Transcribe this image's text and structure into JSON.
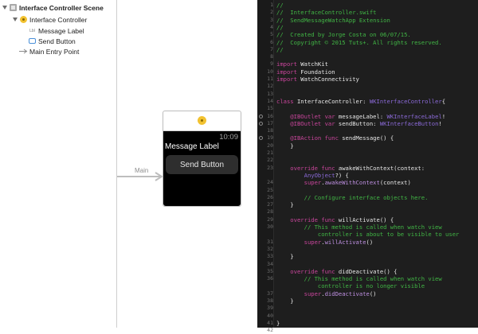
{
  "outline": {
    "scene_label": "Interface Controller Scene",
    "controller_label": "Interface Controller",
    "items": [
      {
        "label": "Message Label",
        "icon_text": "Lbl"
      },
      {
        "label": "Send Button"
      }
    ],
    "entry_point_label": "Main Entry Point"
  },
  "canvas": {
    "entry_label": "Main",
    "watch": {
      "time": "10:09",
      "message_label": "Message Label",
      "send_button": "Send Button"
    }
  },
  "editor": {
    "lines": [
      {
        "n": "1",
        "tokens": [
          {
            "t": "//",
            "c": "com"
          }
        ]
      },
      {
        "n": "2",
        "tokens": [
          {
            "t": "//  InterfaceController.swift",
            "c": "com"
          }
        ]
      },
      {
        "n": "3",
        "tokens": [
          {
            "t": "//  SendMessageWatchApp Extension",
            "c": "com"
          }
        ]
      },
      {
        "n": "4",
        "tokens": [
          {
            "t": "//",
            "c": "com"
          }
        ]
      },
      {
        "n": "5",
        "tokens": [
          {
            "t": "//  Created by Jorge Costa on 06/07/15.",
            "c": "com"
          }
        ]
      },
      {
        "n": "6",
        "tokens": [
          {
            "t": "//  Copyright © 2015 Tuts+. All rights reserved.",
            "c": "com"
          }
        ]
      },
      {
        "n": "7",
        "tokens": [
          {
            "t": "//",
            "c": "com"
          }
        ]
      },
      {
        "n": "8",
        "tokens": []
      },
      {
        "n": "9",
        "tokens": [
          {
            "t": "import",
            "c": "kw"
          },
          {
            "t": " WatchKit",
            "c": "pl"
          }
        ]
      },
      {
        "n": "10",
        "tokens": [
          {
            "t": "import",
            "c": "kw"
          },
          {
            "t": " Foundation",
            "c": "pl"
          }
        ]
      },
      {
        "n": "11",
        "tokens": [
          {
            "t": "import",
            "c": "kw"
          },
          {
            "t": " WatchConnectivity",
            "c": "pl"
          }
        ]
      },
      {
        "n": "12",
        "tokens": []
      },
      {
        "n": "13",
        "tokens": []
      },
      {
        "n": "14",
        "tokens": [
          {
            "t": "class",
            "c": "kw"
          },
          {
            "t": " InterfaceController: ",
            "c": "pl"
          },
          {
            "t": "WKInterfaceController",
            "c": "type"
          },
          {
            "t": "{",
            "c": "pl"
          }
        ]
      },
      {
        "n": "15",
        "tokens": []
      },
      {
        "n": "16",
        "dot": true,
        "tokens": [
          {
            "t": "    @IBOutlet",
            "c": "kw"
          },
          {
            "t": " var",
            "c": "kw"
          },
          {
            "t": " messageLabel: ",
            "c": "pl"
          },
          {
            "t": "WKInterfaceLabel",
            "c": "type"
          },
          {
            "t": "!",
            "c": "pl"
          }
        ]
      },
      {
        "n": "17",
        "dot": true,
        "tokens": [
          {
            "t": "    @IBOutlet",
            "c": "kw"
          },
          {
            "t": " var",
            "c": "kw"
          },
          {
            "t": " sendButton: ",
            "c": "pl"
          },
          {
            "t": "WKInterfaceButton",
            "c": "type"
          },
          {
            "t": "!",
            "c": "pl"
          }
        ]
      },
      {
        "n": "18",
        "tokens": []
      },
      {
        "n": "19",
        "dot": true,
        "tokens": [
          {
            "t": "    @IBAction",
            "c": "kw"
          },
          {
            "t": " func",
            "c": "kw"
          },
          {
            "t": " sendMessage() {",
            "c": "pl"
          }
        ]
      },
      {
        "n": "20",
        "tokens": [
          {
            "t": "    }",
            "c": "pl"
          }
        ]
      },
      {
        "n": "21",
        "tokens": []
      },
      {
        "n": "22",
        "tokens": []
      },
      {
        "n": "23",
        "tokens": [
          {
            "t": "    override",
            "c": "kw"
          },
          {
            "t": " func",
            "c": "kw"
          },
          {
            "t": " awakeWithContext(context:",
            "c": "pl"
          }
        ]
      },
      {
        "n": "",
        "tokens": [
          {
            "t": "        AnyObject",
            "c": "type"
          },
          {
            "t": "?) {",
            "c": "pl"
          }
        ]
      },
      {
        "n": "24",
        "tokens": [
          {
            "t": "        super",
            "c": "kw"
          },
          {
            "t": ".",
            "c": "pl"
          },
          {
            "t": "awakeWithContext",
            "c": "fnc"
          },
          {
            "t": "(context)",
            "c": "pl"
          }
        ]
      },
      {
        "n": "25",
        "tokens": []
      },
      {
        "n": "26",
        "tokens": [
          {
            "t": "        // Configure interface objects here.",
            "c": "com"
          }
        ]
      },
      {
        "n": "27",
        "tokens": [
          {
            "t": "    }",
            "c": "pl"
          }
        ]
      },
      {
        "n": "28",
        "tokens": []
      },
      {
        "n": "29",
        "tokens": [
          {
            "t": "    override",
            "c": "kw"
          },
          {
            "t": " func",
            "c": "kw"
          },
          {
            "t": " willActivate() {",
            "c": "pl"
          }
        ]
      },
      {
        "n": "30",
        "tokens": [
          {
            "t": "        // This method is called when watch view",
            "c": "com"
          }
        ]
      },
      {
        "n": "",
        "tokens": [
          {
            "t": "            controller is about to be visible to user",
            "c": "com"
          }
        ]
      },
      {
        "n": "31",
        "tokens": [
          {
            "t": "        super",
            "c": "kw"
          },
          {
            "t": ".",
            "c": "pl"
          },
          {
            "t": "willActivate",
            "c": "fnc"
          },
          {
            "t": "()",
            "c": "pl"
          }
        ]
      },
      {
        "n": "32",
        "tokens": []
      },
      {
        "n": "33",
        "tokens": [
          {
            "t": "    }",
            "c": "pl"
          }
        ]
      },
      {
        "n": "34",
        "tokens": []
      },
      {
        "n": "35",
        "tokens": [
          {
            "t": "    override",
            "c": "kw"
          },
          {
            "t": " func",
            "c": "kw"
          },
          {
            "t": " didDeactivate() {",
            "c": "pl"
          }
        ]
      },
      {
        "n": "36",
        "tokens": [
          {
            "t": "        // This method is called when watch view",
            "c": "com"
          }
        ]
      },
      {
        "n": "",
        "tokens": [
          {
            "t": "            controller is no longer visible",
            "c": "com"
          }
        ]
      },
      {
        "n": "37",
        "tokens": [
          {
            "t": "        super",
            "c": "kw"
          },
          {
            "t": ".",
            "c": "pl"
          },
          {
            "t": "didDeactivate",
            "c": "fnc"
          },
          {
            "t": "()",
            "c": "pl"
          }
        ]
      },
      {
        "n": "38",
        "tokens": [
          {
            "t": "    }",
            "c": "pl"
          }
        ]
      },
      {
        "n": "39",
        "tokens": []
      },
      {
        "n": "40",
        "tokens": []
      },
      {
        "n": "41",
        "tokens": [
          {
            "t": "}",
            "c": "pl"
          }
        ]
      },
      {
        "n": "42",
        "tokens": []
      }
    ]
  },
  "colors": {
    "comment": "#41b645",
    "keyword": "#c8459b",
    "plain": "#e6e6e6",
    "type": "#8b6ad8",
    "function_call": "#bd8fe0",
    "editor_bg": "#1e1e1e",
    "controller_icon": "#f2c230"
  }
}
